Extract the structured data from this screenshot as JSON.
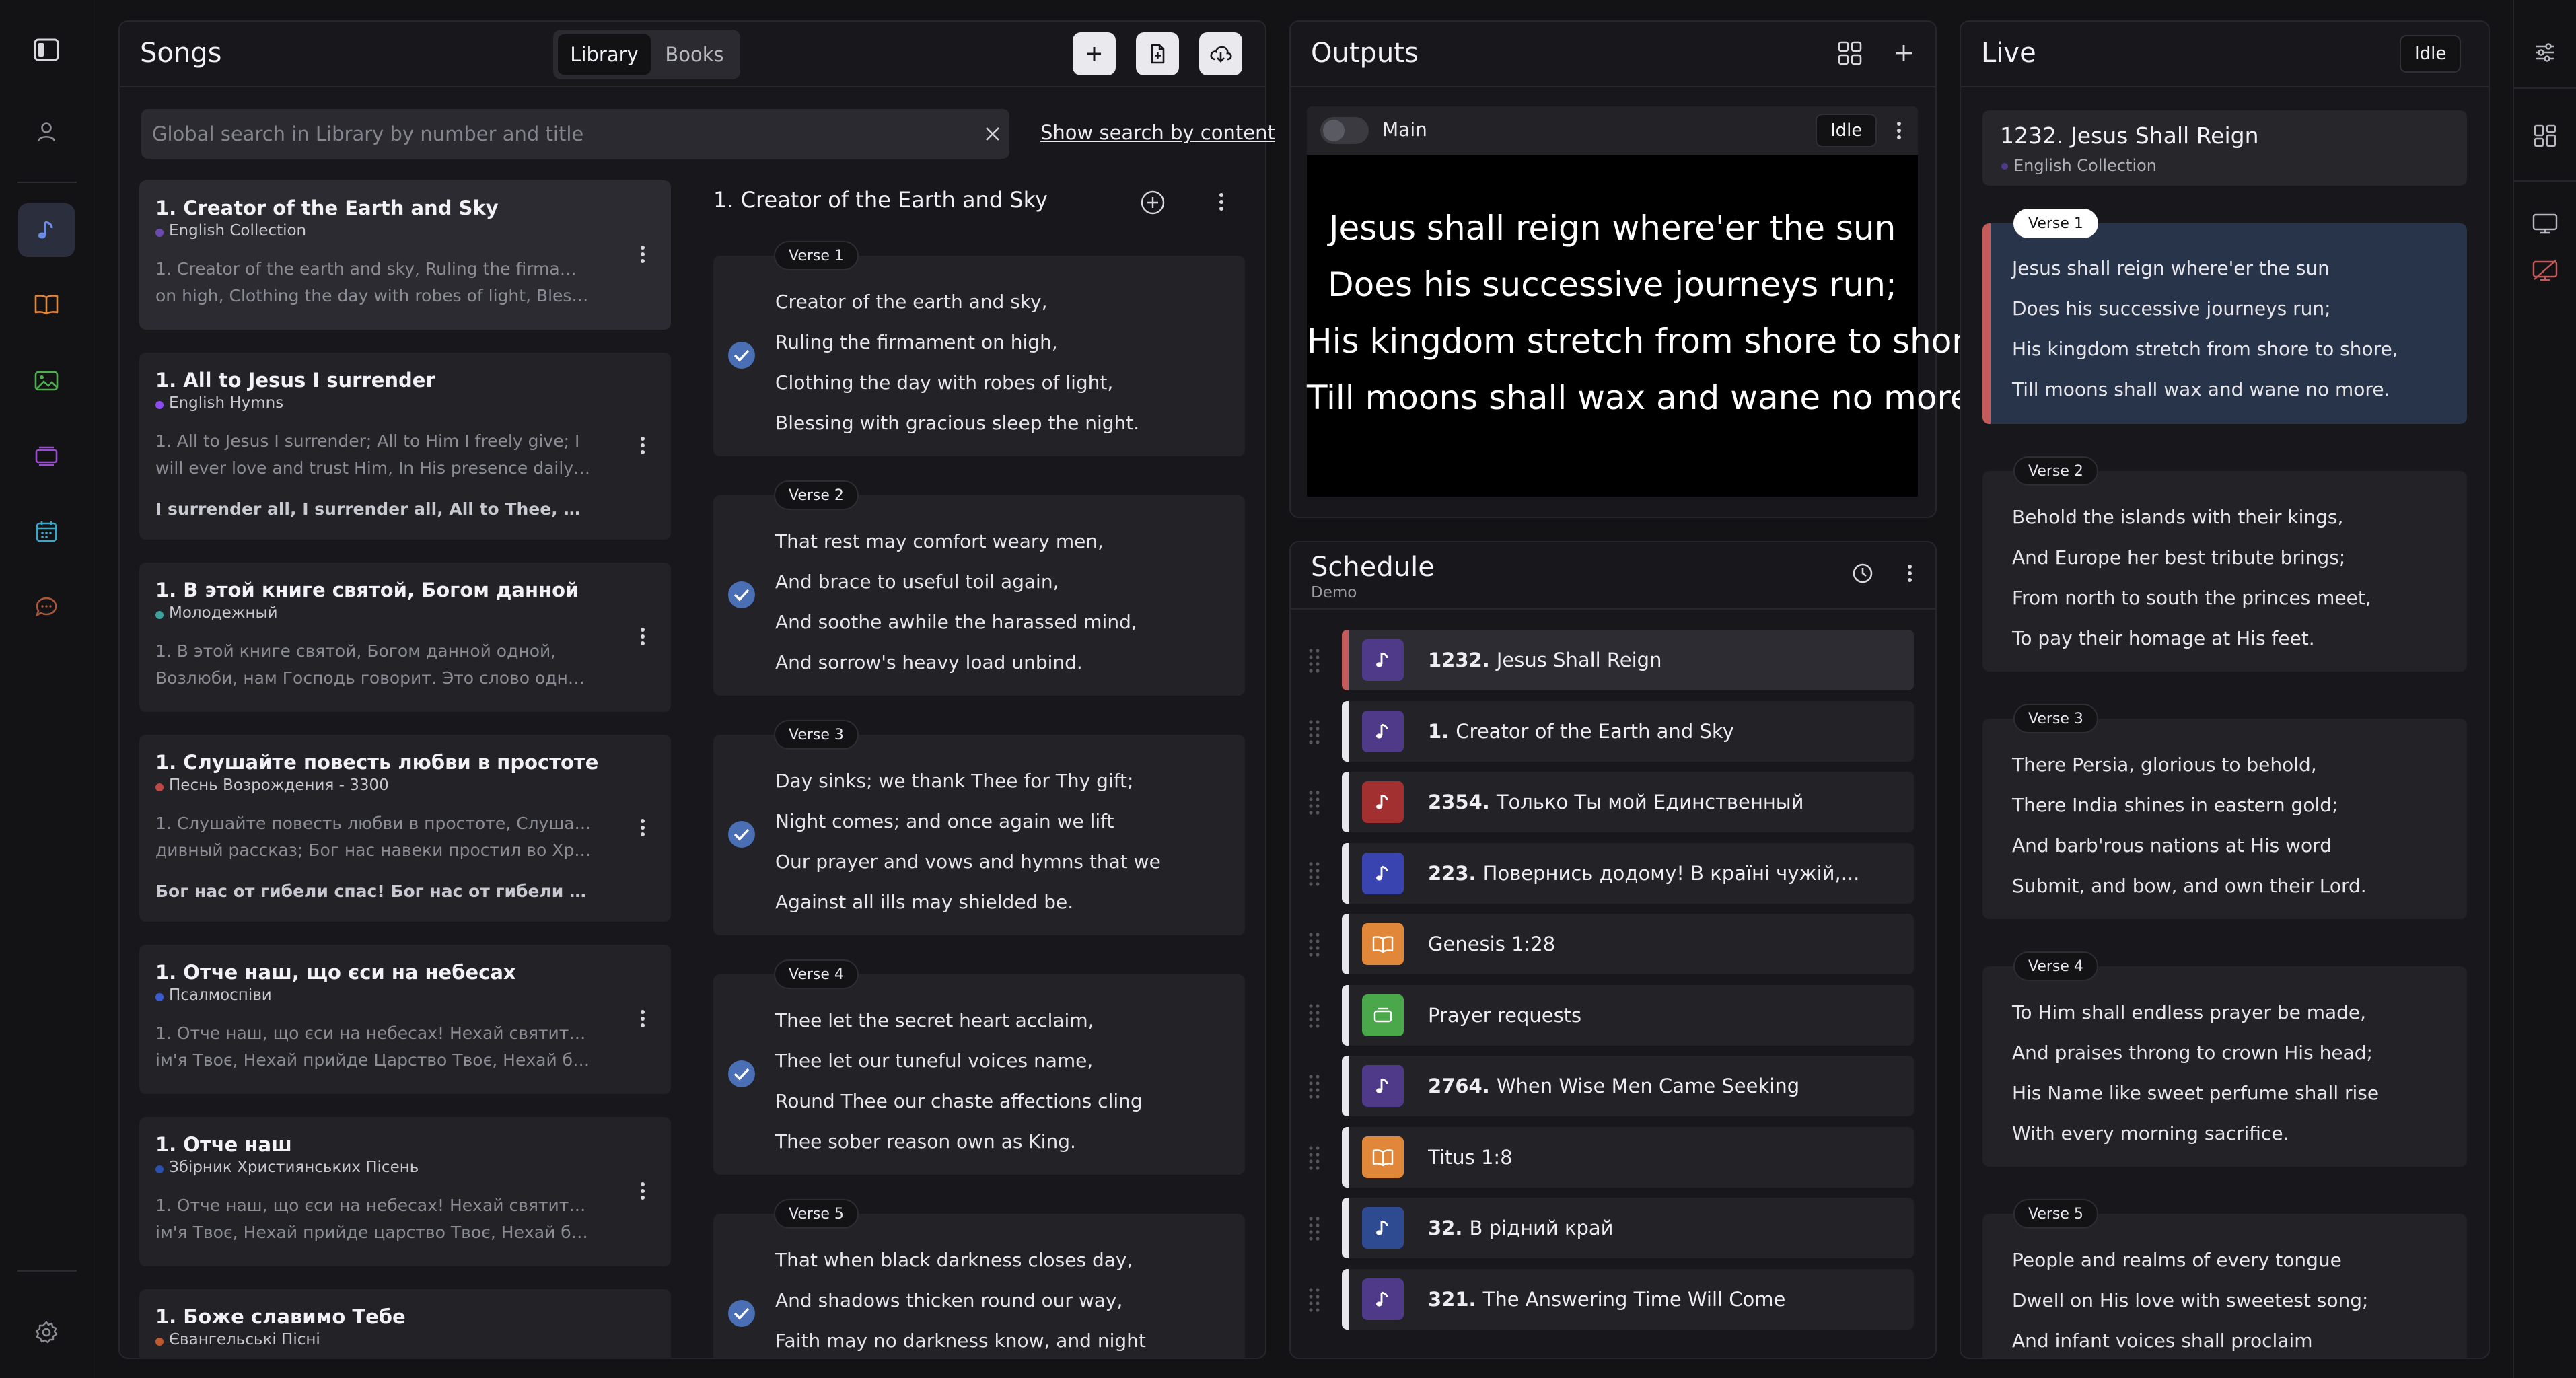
{
  "colors": {
    "background": "#131316",
    "panel": "#18181c",
    "card": "#222227",
    "accent_blue": "#4a6fb5",
    "live_red": "#c45a5a",
    "live_highlight": "#28344a"
  },
  "nav": {
    "icons": [
      "sidebar-toggle-icon",
      "user-icon",
      "music-note-icon",
      "book-icon",
      "image-icon",
      "slides-icon",
      "calendar-icon",
      "chat-icon",
      "gear-icon"
    ]
  },
  "songs_panel": {
    "title": "Songs",
    "tabs": [
      "Library",
      "Books"
    ],
    "active_tab": "Library",
    "search_placeholder": "Global search in Library by number and title",
    "search_by_content": "Show search by content",
    "list": [
      {
        "title": "1. Creator of the Earth and Sky",
        "collection": "English Collection",
        "dot": "#6a4bb0",
        "preview": [
          "1. Creator of the earth and sky, Ruling the firmament",
          "on high, Clothing the day with robes of light, Blessin..."
        ],
        "chorus": ""
      },
      {
        "title": "1. All to Jesus I surrender",
        "collection": "English Hymns",
        "dot": "#8a4cf0",
        "preview": [
          "1. All to Jesus I surrender; All to Him I freely give; I",
          "will ever love and trust Him, In His presence daily live."
        ],
        "chorus": "I surrender all, I surrender all, All to Thee, my..."
      },
      {
        "title": "1. В этой книге святой, Богом данной",
        "collection": "Молодежный",
        "dot": "#3aa3a0",
        "preview": [
          "1. В этой книге святой, Богом данной одной,",
          "Возлюби, нам Господь говорит. Это слово одно,..."
        ],
        "chorus": ""
      },
      {
        "title": "1. Слушайте повесть любви в простоте",
        "collection": "Песнь Возрождения - 3300",
        "dot": "#c04848",
        "preview": [
          "1. Слушайте повесть любви в простоте, Слушайте",
          "дивный рассказ; Бог нас навеки простил во Христ..."
        ],
        "chorus": "Бог нас от гибели спас! Бог нас от гибели спас!..."
      },
      {
        "title": "1. Отче наш, що єси на небесах",
        "collection": "Псалмоспіви",
        "dot": "#3a5ad0",
        "preview": [
          "1. Отче наш, що єси на небесах! Нехай святиться",
          "ім'я Твоє, Нехай прийде Царство Твоє, Нехай буд..."
        ],
        "chorus": ""
      },
      {
        "title": "1. Отче наш",
        "collection": "Збірник Християнських Пісень",
        "dot": "#2a50b0",
        "preview": [
          "1. Отче наш, що єси на небесах! Нехай святиться",
          "ім'я Твоє, Нехай прийде царство Твоє, Нехай буде..."
        ],
        "chorus": ""
      },
      {
        "title": "1. Боже славимо Тебе",
        "collection": "Євангельські Пісні",
        "dot": "#c05a30",
        "preview": [],
        "chorus": ""
      }
    ],
    "detail": {
      "title": "1. Creator of the Earth and Sky",
      "verses": [
        {
          "label": "Verse 1",
          "lines": [
            "Creator of the earth and sky,",
            "Ruling the firmament on high,",
            "Clothing the day with robes of light,",
            "Blessing with gracious sleep the night."
          ]
        },
        {
          "label": "Verse 2",
          "lines": [
            "That rest may comfort weary men,",
            "And brace to useful toil again,",
            "And soothe awhile the harassed mind,",
            "And sorrow's heavy load unbind."
          ]
        },
        {
          "label": "Verse 3",
          "lines": [
            "Day sinks; we thank Thee for Thy gift;",
            "Night comes; and once again we lift",
            "Our prayer and vows and hymns that we",
            "Against all ills may shielded be."
          ]
        },
        {
          "label": "Verse 4",
          "lines": [
            "Thee let the secret heart acclaim,",
            "Thee let our tuneful voices name,",
            "Round Thee our chaste affections cling",
            "Thee sober reason own as King."
          ]
        },
        {
          "label": "Verse 5",
          "lines": [
            "That when black darkness closes day,",
            "And shadows thicken round our way,",
            "Faith may no darkness know, and night"
          ]
        }
      ]
    }
  },
  "outputs_panel": {
    "title": "Outputs",
    "output_name": "Main",
    "status": "Idle",
    "screen_lines": [
      "Jesus shall reign where'er the sun",
      "Does his successive journeys run;",
      "His kingdom stretch from shore to shore,",
      "Till moons shall wax and wane no more."
    ]
  },
  "schedule_panel": {
    "title": "Schedule",
    "subtitle": "Demo",
    "items": [
      {
        "num": "1232.",
        "label": "Jesus Shall Reign",
        "kind": "song",
        "icon_color": "#4f3a8a",
        "live": true
      },
      {
        "num": "1.",
        "label": "Creator of the Earth and Sky",
        "kind": "song",
        "icon_color": "#4f3a8a",
        "live": false
      },
      {
        "num": "2354.",
        "label": "Только Ты мой Единственный",
        "kind": "song",
        "icon_color": "#a33030",
        "live": false
      },
      {
        "num": "223.",
        "label": "Повернись додому! В країні чужій,...",
        "kind": "song",
        "icon_color": "#3a44b0",
        "live": false
      },
      {
        "num": "",
        "label": "Genesis 1:28",
        "kind": "bible",
        "icon_color": "#e0873a",
        "live": false
      },
      {
        "num": "",
        "label": "Prayer requests",
        "kind": "slides",
        "icon_color": "#4aa84a",
        "live": false
      },
      {
        "num": "2764.",
        "label": "When Wise Men Came Seeking",
        "kind": "song",
        "icon_color": "#4f3a8a",
        "live": false
      },
      {
        "num": "",
        "label": "Titus 1:8",
        "kind": "bible",
        "icon_color": "#e0873a",
        "live": false
      },
      {
        "num": "32.",
        "label": "В рідний край",
        "kind": "song",
        "icon_color": "#2e4a90",
        "live": false
      },
      {
        "num": "321.",
        "label": "The Answering Time Will Come",
        "kind": "song",
        "icon_color": "#4f3a8a",
        "live": false
      }
    ]
  },
  "live_panel": {
    "title": "Live",
    "status": "Idle",
    "song_title": "1232. Jesus Shall Reign",
    "song_collection": "English Collection",
    "verses": [
      {
        "label": "Verse 1",
        "lines": [
          "Jesus shall reign where'er the sun",
          "Does his successive journeys run;",
          "His kingdom stretch from shore to shore,",
          "Till moons shall wax and wane no more."
        ]
      },
      {
        "label": "Verse 2",
        "lines": [
          "Behold the islands with their kings,",
          "And Europe her best tribute brings;",
          "From north to south the princes meet,",
          "To pay their homage at His feet."
        ]
      },
      {
        "label": "Verse 3",
        "lines": [
          "There Persia, glorious to behold,",
          "There India shines in eastern gold;",
          "And barb'rous nations at His word",
          "Submit, and bow, and own their Lord."
        ]
      },
      {
        "label": "Verse 4",
        "lines": [
          "To Him shall endless prayer be made,",
          "And praises throng to crown His head;",
          "His Name like sweet perfume shall rise",
          "With every morning sacrifice."
        ]
      },
      {
        "label": "Verse 5",
        "lines": [
          "People and realms of every tongue",
          "Dwell on His love with sweetest song;",
          "And infant voices shall proclaim"
        ]
      }
    ]
  }
}
